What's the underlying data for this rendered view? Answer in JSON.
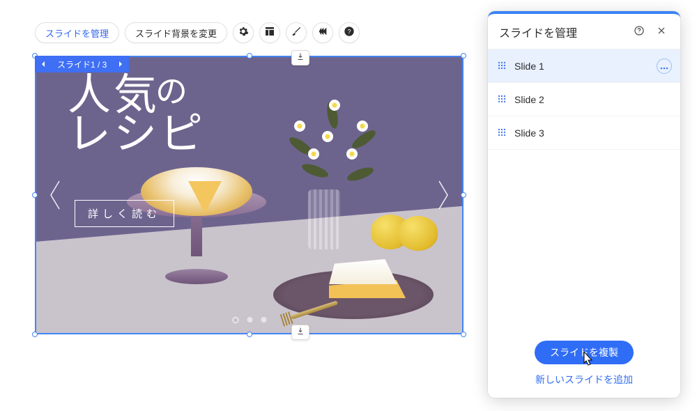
{
  "toolbar": {
    "manage_label": "スライドを管理",
    "background_label": "スライド背景を変更"
  },
  "badge": {
    "label": "スライド1 / 3"
  },
  "hero": {
    "line1": "人気",
    "particle": "の",
    "line2": "レシピ",
    "cta": "詳しく読む"
  },
  "panel": {
    "title": "スライドを管理",
    "items": [
      {
        "label": "Slide 1"
      },
      {
        "label": "Slide 2"
      },
      {
        "label": "Slide 3"
      }
    ],
    "duplicate_label": "スライドを複製",
    "add_label": "新しいスライドを追加"
  }
}
